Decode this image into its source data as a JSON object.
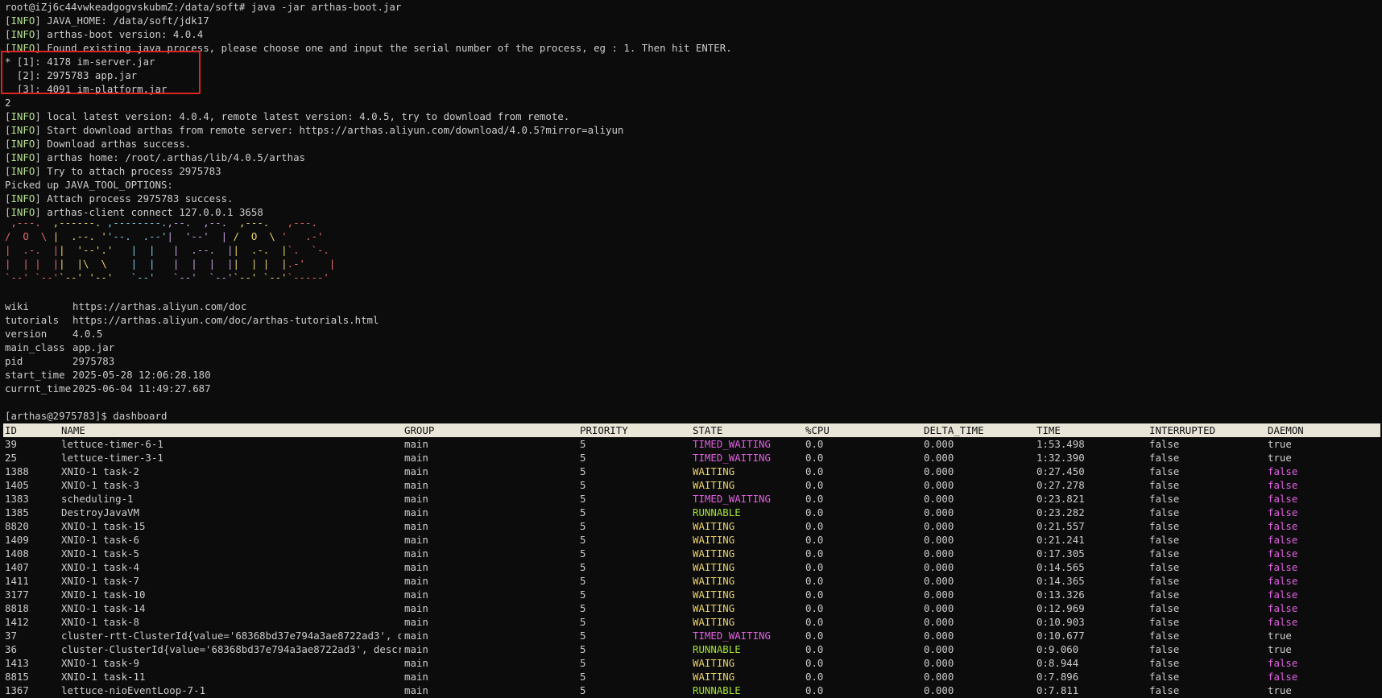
{
  "prompt_line": "root@iZj6c44vwkeadgogvskubmZ:/data/soft# java -jar arthas-boot.jar",
  "info_tag": "INFO",
  "boot_logs": [
    "JAVA_HOME: /data/soft/jdk17",
    "arthas-boot version: 4.0.4",
    "Found existing java process, please choose one and input the serial number of the process, eg : 1. Then hit ENTER."
  ],
  "processes": [
    "* [1]: 4178 im-server.jar",
    "  [2]: 2975783 app.jar",
    "  [3]: 4091 im-platform.jar"
  ],
  "user_input": "2",
  "attach_logs_1": [
    "local latest version: 4.0.4, remote latest version: 4.0.5, try to download from remote.",
    "Start download arthas from remote server: https://arthas.aliyun.com/download/4.0.5?mirror=aliyun",
    "Download arthas success.",
    "arthas home: /root/.arthas/lib/4.0.5/arthas",
    "Try to attach process 2975783"
  ],
  "picked_up": "Picked up JAVA_TOOL_OPTIONS:",
  "attach_logs_2": [
    "Attach process 2975783 success.",
    "arthas-client connect 127.0.0.1 3658"
  ],
  "banner": [
    [
      " ,---. ",
      " ,------. ",
      ",--------.",
      ",--.  ,--.",
      "  ,---.  ",
      " ,---.  "
    ],
    [
      "/  O  \\ ",
      "|  .--. '",
      "'--.  .--'",
      "|  '--'  |",
      " /  O  \\ ",
      "'   .-' "
    ],
    [
      "|  .-.  |",
      "|  '--'.'",
      "   |  |   ",
      "|  .--.  |",
      "|  .-.  |",
      "`.  `-. "
    ],
    [
      "|  | |  |",
      "|  |\\  \\ ",
      "   |  |   ",
      "|  |  |  |",
      "|  | |  |",
      ".-'    |"
    ],
    [
      "`--' `--'",
      "`--' '--'",
      "   `--'   ",
      "`--'  `--'",
      "`--' `--'",
      "`-----' "
    ]
  ],
  "banner_colors": [
    "#e06c6c",
    "#e8d36a",
    "#7ec8e3",
    "#c9a0dc",
    "#e8d36a",
    "#e06c6c"
  ],
  "meta": [
    {
      "key": "wiki",
      "value": "https://arthas.aliyun.com/doc"
    },
    {
      "key": "tutorials",
      "value": "https://arthas.aliyun.com/doc/arthas-tutorials.html"
    },
    {
      "key": "version",
      "value": "4.0.5"
    },
    {
      "key": "main_class",
      "value": "app.jar"
    },
    {
      "key": "pid",
      "value": "2975783"
    },
    {
      "key": "start_time",
      "value": "2025-05-28 12:06:28.180"
    },
    {
      "key": "currnt_time",
      "value": "2025-06-04 11:49:27.687"
    }
  ],
  "arthas_prompt": "[arthas@2975783]$ dashboard",
  "table": {
    "headers": [
      "ID",
      "NAME",
      "GROUP",
      "PRIORITY",
      "STATE",
      "%CPU",
      "DELTA_TIME",
      "TIME",
      "INTERRUPTED",
      "DAEMON"
    ],
    "rows": [
      [
        "39",
        "lettuce-timer-6-1",
        "main",
        "5",
        "TIMED_WAITING",
        "0.0",
        "0.000",
        "1:53.498",
        "false",
        "true"
      ],
      [
        "25",
        "lettuce-timer-3-1",
        "main",
        "5",
        "TIMED_WAITING",
        "0.0",
        "0.000",
        "1:32.390",
        "false",
        "true"
      ],
      [
        "1388",
        "XNIO-1 task-2",
        "main",
        "5",
        "WAITING",
        "0.0",
        "0.000",
        "0:27.450",
        "false",
        "false"
      ],
      [
        "1405",
        "XNIO-1 task-3",
        "main",
        "5",
        "WAITING",
        "0.0",
        "0.000",
        "0:27.278",
        "false",
        "false"
      ],
      [
        "1383",
        "scheduling-1",
        "main",
        "5",
        "TIMED_WAITING",
        "0.0",
        "0.000",
        "0:23.821",
        "false",
        "false"
      ],
      [
        "1385",
        "DestroyJavaVM",
        "main",
        "5",
        "RUNNABLE",
        "0.0",
        "0.000",
        "0:23.282",
        "false",
        "false"
      ],
      [
        "8820",
        "XNIO-1 task-15",
        "main",
        "5",
        "WAITING",
        "0.0",
        "0.000",
        "0:21.557",
        "false",
        "false"
      ],
      [
        "1409",
        "XNIO-1 task-6",
        "main",
        "5",
        "WAITING",
        "0.0",
        "0.000",
        "0:21.241",
        "false",
        "false"
      ],
      [
        "1408",
        "XNIO-1 task-5",
        "main",
        "5",
        "WAITING",
        "0.0",
        "0.000",
        "0:17.305",
        "false",
        "false"
      ],
      [
        "1407",
        "XNIO-1 task-4",
        "main",
        "5",
        "WAITING",
        "0.0",
        "0.000",
        "0:14.565",
        "false",
        "false"
      ],
      [
        "1411",
        "XNIO-1 task-7",
        "main",
        "5",
        "WAITING",
        "0.0",
        "0.000",
        "0:14.365",
        "false",
        "false"
      ],
      [
        "3177",
        "XNIO-1 task-10",
        "main",
        "5",
        "WAITING",
        "0.0",
        "0.000",
        "0:13.326",
        "false",
        "false"
      ],
      [
        "8818",
        "XNIO-1 task-14",
        "main",
        "5",
        "WAITING",
        "0.0",
        "0.000",
        "0:12.969",
        "false",
        "false"
      ],
      [
        "1412",
        "XNIO-1 task-8",
        "main",
        "5",
        "WAITING",
        "0.0",
        "0.000",
        "0:10.903",
        "false",
        "false"
      ],
      [
        "37",
        "cluster-rtt-ClusterId{value='68368bd37e794a3ae8722ad3', desc",
        "main",
        "5",
        "TIMED_WAITING",
        "0.0",
        "0.000",
        "0:10.677",
        "false",
        "true"
      ],
      [
        "36",
        "cluster-ClusterId{value='68368bd37e794a3ae8722ad3', descript",
        "main",
        "5",
        "RUNNABLE",
        "0.0",
        "0.000",
        "0:9.060",
        "false",
        "true"
      ],
      [
        "1413",
        "XNIO-1 task-9",
        "main",
        "5",
        "WAITING",
        "0.0",
        "0.000",
        "0:8.944",
        "false",
        "false"
      ],
      [
        "8815",
        "XNIO-1 task-11",
        "main",
        "5",
        "WAITING",
        "0.0",
        "0.000",
        "0:7.896",
        "false",
        "false"
      ],
      [
        "1367",
        "lettuce-nioEventLoop-7-1",
        "main",
        "5",
        "RUNNABLE",
        "0.0",
        "0.000",
        "0:7.811",
        "false",
        "true"
      ]
    ]
  }
}
